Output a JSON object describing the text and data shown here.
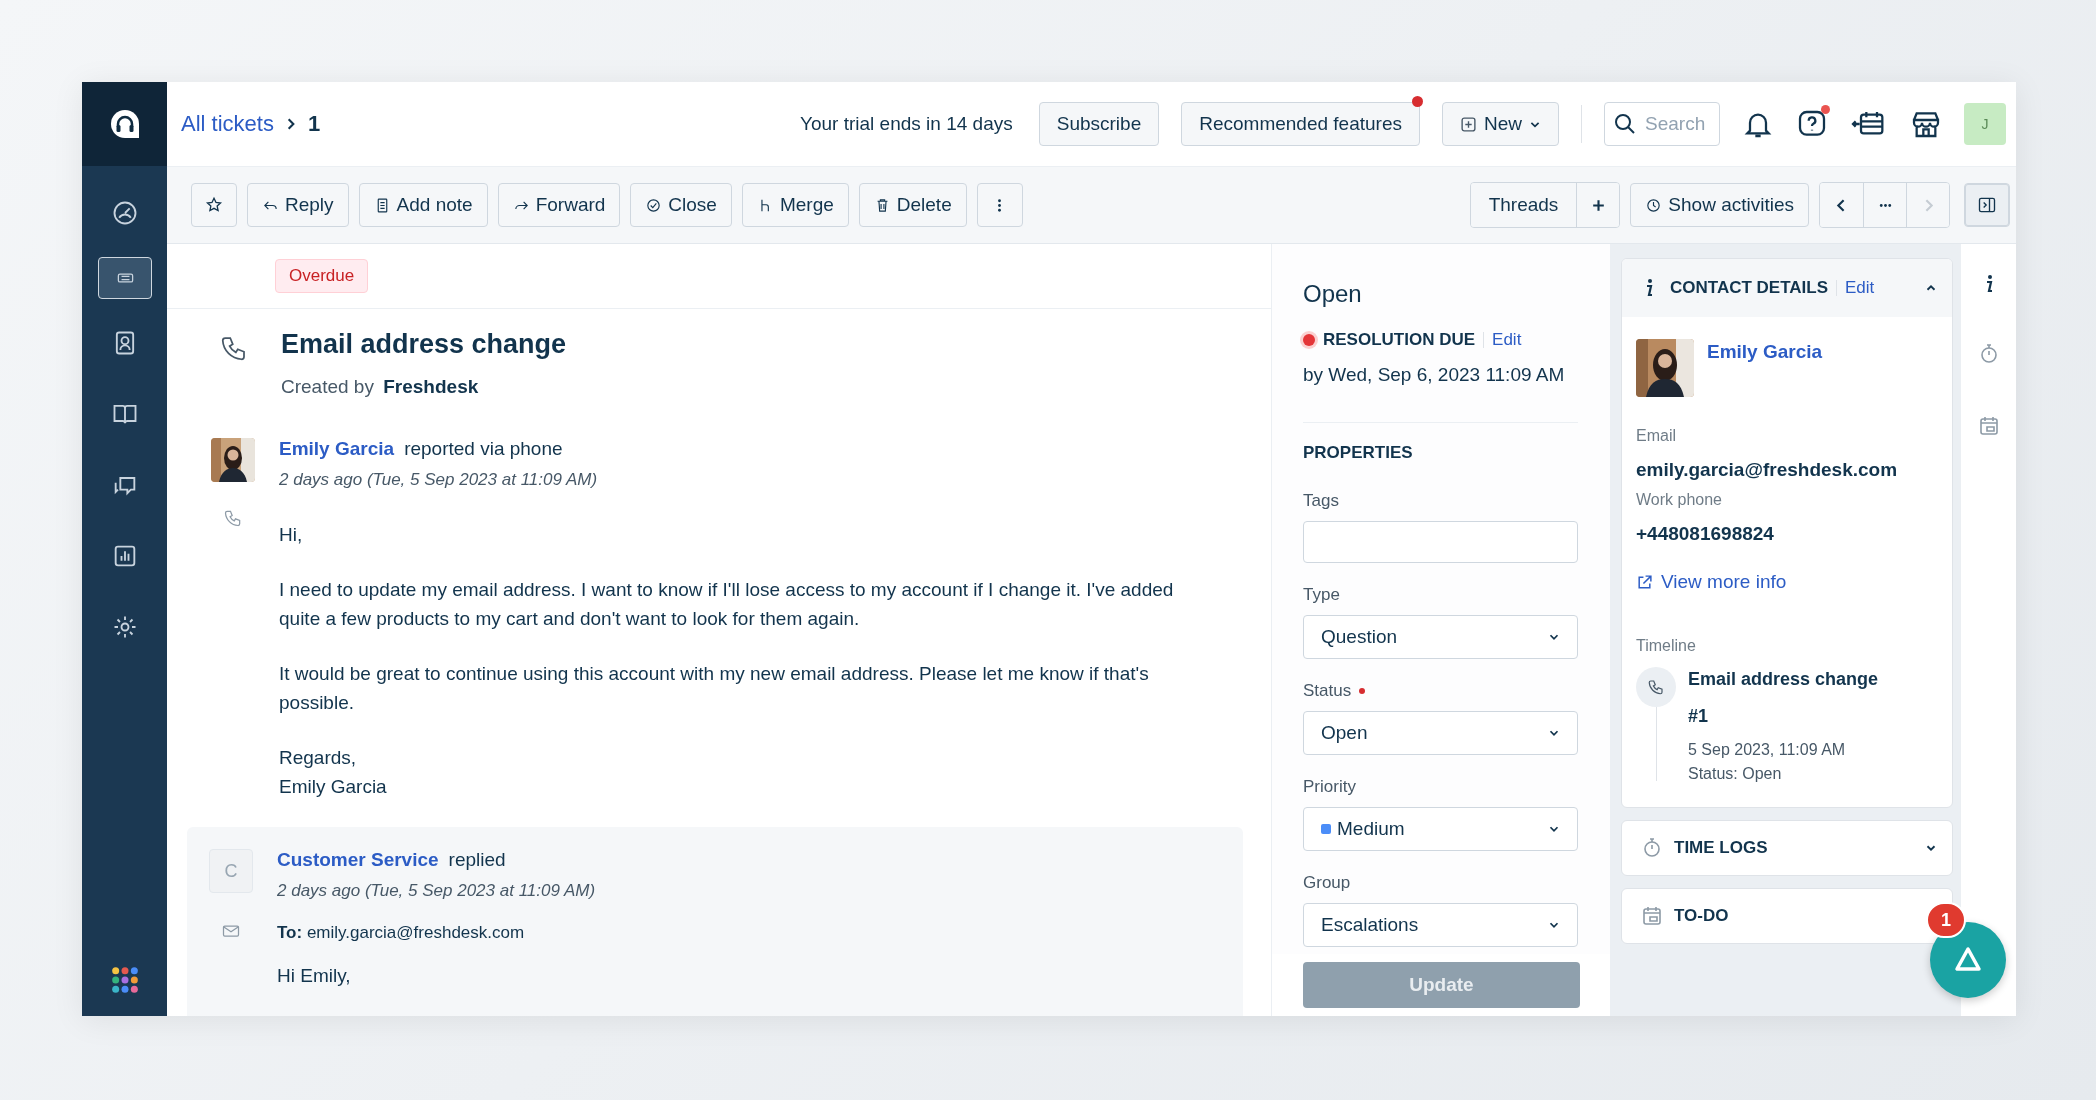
{
  "sidebar": {
    "items": [
      {
        "kind": "dashboard",
        "selected": false
      },
      {
        "kind": "tickets",
        "selected": true
      },
      {
        "kind": "contacts",
        "selected": false
      },
      {
        "kind": "knowledge",
        "selected": false
      },
      {
        "kind": "conversations",
        "selected": false
      },
      {
        "kind": "reports",
        "selected": false
      },
      {
        "kind": "settings",
        "selected": false
      }
    ]
  },
  "top_bar": {
    "breadcrumb": {
      "link": "All tickets",
      "current": "1"
    },
    "trial": "Your trial ends in 14 days",
    "subscribe": "Subscribe",
    "recommended": {
      "label": "Recommended features",
      "notification": true
    },
    "new_button": "New",
    "search": {
      "placeholder": "Search"
    },
    "help_notification": true,
    "avatar_initial": "J"
  },
  "toolbar": {
    "actions": [
      {
        "kind": "reply",
        "label": "Reply"
      },
      {
        "kind": "note",
        "label": "Add note"
      },
      {
        "kind": "forward",
        "label": "Forward"
      },
      {
        "kind": "close",
        "label": "Close"
      },
      {
        "kind": "merge",
        "label": "Merge"
      },
      {
        "kind": "delete",
        "label": "Delete"
      }
    ],
    "threads": "Threads",
    "show_activities": "Show activities",
    "next_disabled": true
  },
  "ticket": {
    "overdue": "Overdue",
    "title": "Email address change",
    "created_by_label": "Created by",
    "created_by": "Freshdesk",
    "message": {
      "author": "Emily Garcia",
      "action": "reported via phone",
      "time": "2 days ago (Tue, 5 Sep 2023 at 11:09 AM)",
      "body": [
        "Hi,",
        "I need to update my email address. I want to know if I'll lose access to my account if I change it. I've added quite a few products to my cart and don't want to look for them again.",
        "It would be great to continue using this account with my new email address. Please let me know if that's possible.",
        "Regards,\nEmily Garcia"
      ]
    },
    "reply": {
      "avatar_initial": "C",
      "author": "Customer Service",
      "action": "replied",
      "time": "2 days ago (Tue, 5 Sep 2023 at 11:09 AM)",
      "to": "**To:** emily.garcia@freshdesk.com",
      "body": [
        "Hi Emily,"
      ]
    }
  },
  "properties": {
    "status_title": "Open",
    "resolution": {
      "label": "RESOLUTION DUE",
      "edit": "Edit",
      "due": "by Wed, Sep 6, 2023 11:09 AM"
    },
    "heading": "PROPERTIES",
    "fields": [
      {
        "label": "Tags",
        "kind": "text",
        "required": false
      },
      {
        "label": "Type",
        "kind": "select",
        "value": "Question",
        "required": false
      },
      {
        "label": "Status",
        "kind": "select",
        "value": "Open",
        "required": true
      },
      {
        "label": "Priority",
        "kind": "select",
        "value": "Medium",
        "color": "#4b8df8",
        "required": false
      },
      {
        "label": "Group",
        "kind": "select",
        "value": "Escalations",
        "required": false
      }
    ],
    "update": {
      "label": "Update",
      "disabled": true
    }
  },
  "contact": {
    "heading": "CONTACT DETAILS",
    "edit": "Edit",
    "expanded": true,
    "name": "Emily Garcia",
    "fields": [
      {
        "label": "Email",
        "value": "emily.garcia@freshdesk.com"
      },
      {
        "label": "Work phone",
        "value": "+448081698824"
      }
    ],
    "view_more": "View more info",
    "timeline_label": "Timeline",
    "timeline": [
      {
        "title": "Email address change",
        "number": "#1",
        "date": "5 Sep 2023, 11:09 AM",
        "status": "Status: Open"
      }
    ]
  },
  "panels": [
    {
      "kind": "timelogs",
      "label": "TIME LOGS",
      "expanded": false
    },
    {
      "kind": "todo",
      "label": "TO-DO"
    }
  ],
  "fab": {
    "badge": "1"
  }
}
